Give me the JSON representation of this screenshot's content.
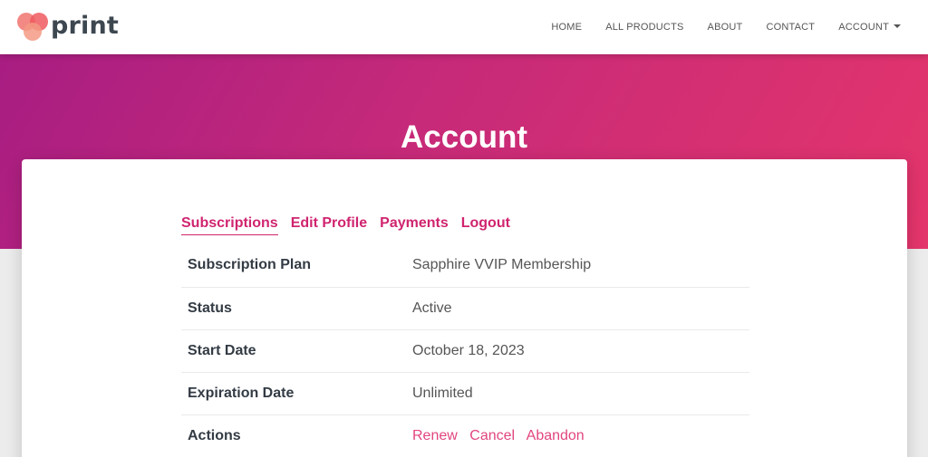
{
  "brand": {
    "name": "print"
  },
  "nav": {
    "items": [
      "HOME",
      "ALL PRODUCTS",
      "ABOUT",
      "CONTACT"
    ],
    "account_label": "ACCOUNT"
  },
  "hero": {
    "title": "Account"
  },
  "tabs": [
    {
      "label": "Subscriptions",
      "active": true
    },
    {
      "label": "Edit Profile",
      "active": false
    },
    {
      "label": "Payments",
      "active": false
    },
    {
      "label": "Logout",
      "active": false
    }
  ],
  "subscription": {
    "rows": [
      {
        "label": "Subscription Plan",
        "value": "Sapphire VVIP Membership"
      },
      {
        "label": "Status",
        "value": "Active"
      },
      {
        "label": "Start Date",
        "value": "October 18, 2023"
      },
      {
        "label": "Expiration Date",
        "value": "Unlimited"
      }
    ],
    "actions_label": "Actions",
    "actions": [
      "Renew",
      "Cancel",
      "Abandon"
    ]
  },
  "colors": {
    "accent": "#d0246f",
    "hero_start": "#a81d82",
    "hero_end": "#e4356b"
  }
}
